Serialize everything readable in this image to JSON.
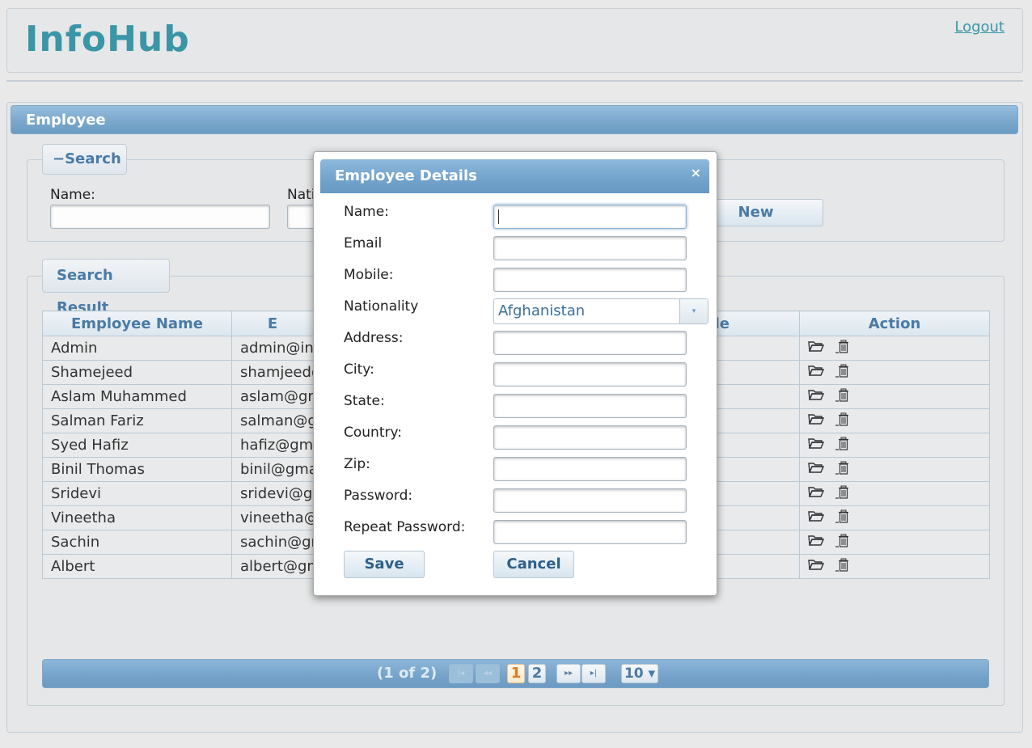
{
  "app": {
    "title": "InfoHub",
    "logout_label": "Logout"
  },
  "panel": {
    "title": "Employee"
  },
  "search": {
    "legend_icon": "−",
    "legend_label": "Search",
    "name_label": "Name:",
    "nationality_label": "Nati",
    "new_button_label": "New"
  },
  "results": {
    "legend_label": "Search Result",
    "columns": [
      "Employee Name",
      "E",
      "le",
      "Action"
    ],
    "rows": [
      {
        "name": "Admin",
        "email": "admin@inf"
      },
      {
        "name": "Shamejeed",
        "email": "shamjeed@"
      },
      {
        "name": "Aslam Muhammed",
        "email": "aslam@gm"
      },
      {
        "name": "Salman Fariz",
        "email": "salman@gr"
      },
      {
        "name": "Syed Hafiz",
        "email": "hafiz@gma"
      },
      {
        "name": "Binil Thomas",
        "email": "binil@gma"
      },
      {
        "name": "Sridevi",
        "email": "sridevi@gn"
      },
      {
        "name": "Vineetha",
        "email": "vineetha@g"
      },
      {
        "name": "Sachin",
        "email": "sachin@gm"
      },
      {
        "name": "Albert",
        "email": "albert@gm"
      }
    ],
    "action_icons": [
      "folder-open-icon",
      "trash-icon"
    ]
  },
  "paginator": {
    "summary": "(1 of 2)",
    "first_glyph": "|◂",
    "prev_glyph": "◂◂",
    "next_glyph": "▸▸",
    "last_glyph": "▸|",
    "pages": [
      "1",
      "2"
    ],
    "current_page": "1",
    "rows_per_page": "10 ▾"
  },
  "dialog": {
    "title": "Employee Details",
    "close_glyph": "×",
    "fields": [
      {
        "label": "Name:",
        "value": ""
      },
      {
        "label": "Email",
        "value": ""
      },
      {
        "label": "Mobile:",
        "value": ""
      },
      {
        "label": "Nationality",
        "value": "Afghanistan"
      },
      {
        "label": "Address:",
        "value": ""
      },
      {
        "label": "City:",
        "value": ""
      },
      {
        "label": "State:",
        "value": ""
      },
      {
        "label": "Country:",
        "value": ""
      },
      {
        "label": "Zip:",
        "value": ""
      },
      {
        "label": "Password:",
        "value": ""
      },
      {
        "label": "Repeat Password:",
        "value": ""
      }
    ],
    "nationality_dropdown_glyph": "▾",
    "save_label": "Save",
    "cancel_label": "Cancel"
  }
}
